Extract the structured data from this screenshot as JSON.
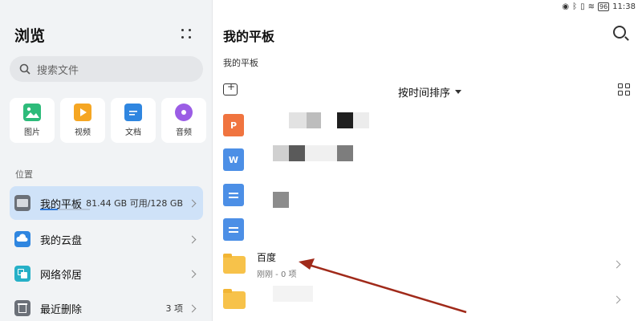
{
  "sidebar": {
    "title": "浏览",
    "search_placeholder": "搜索文件",
    "categories": [
      {
        "label": "图片",
        "icon": "image-icon",
        "color": "#2dbb7a"
      },
      {
        "label": "视频",
        "icon": "video-icon",
        "color": "#f5a623"
      },
      {
        "label": "文档",
        "icon": "document-icon",
        "color": "#2f86e0"
      },
      {
        "label": "音频",
        "icon": "audio-icon",
        "color": "#9b5de5"
      }
    ],
    "section_label": "位置",
    "locations": [
      {
        "label": "我的平板",
        "meta": "81.44 GB 可用/128 GB",
        "usage_fraction": 0.36,
        "active": true
      },
      {
        "label": "我的云盘",
        "meta": ""
      },
      {
        "label": "网络邻居",
        "meta": ""
      },
      {
        "label": "最近删除",
        "meta": "3 项"
      }
    ]
  },
  "status_bar": {
    "battery": "96",
    "time": "11:38"
  },
  "main": {
    "title": "我的平板",
    "breadcrumb": "我的平板",
    "sort_label": "按时间排序",
    "files": [
      {
        "type": "ppt",
        "badge": "P",
        "color": "#f0743f"
      },
      {
        "type": "word",
        "badge": "W",
        "color": "#4c8fe6"
      },
      {
        "type": "doc",
        "badge": "",
        "color": "#4c8fe6"
      },
      {
        "type": "doc",
        "badge": "",
        "color": "#4c8fe6"
      },
      {
        "type": "folder",
        "name": "百度",
        "sub": "刚刚 - 0 项"
      },
      {
        "type": "folder",
        "name": "",
        "sub": ""
      }
    ]
  },
  "colors": {
    "accent": "#2f78d8",
    "active_bg": "#cfe2f8",
    "annotation_arrow": "#a02a1a"
  }
}
